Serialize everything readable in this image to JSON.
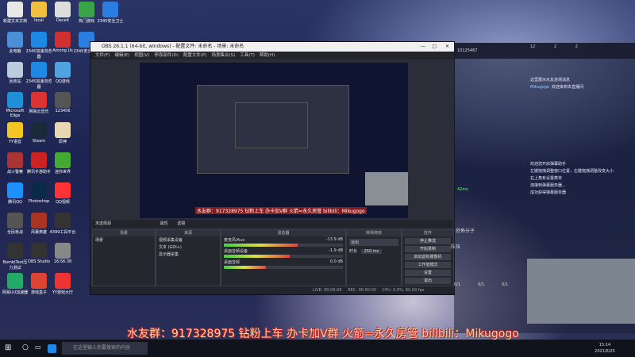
{
  "desktop_icons": [
    {
      "label": "新建文本文档",
      "color": "#e8e8e8"
    },
    {
      "label": "local",
      "color": "#f0c040"
    },
    {
      "label": "Deceit",
      "color": "#ddd"
    },
    {
      "label": "热门游戏",
      "color": "#3aa34a"
    },
    {
      "label": "2345安全卫士",
      "color": "#2a7de1"
    },
    {
      "label": "此电脑",
      "color": "#4a90d9"
    },
    {
      "label": "2345加速浏览器",
      "color": "#1e88e5"
    },
    {
      "label": "Among Us",
      "color": "#d03030"
    },
    {
      "label": "2345安全卫士",
      "color": "#2a7de1"
    },
    {
      "label": "回收站",
      "color": "#bcd"
    },
    {
      "label": "2345加速浏览器",
      "color": "#1e88e5"
    },
    {
      "label": "QQ游戏",
      "color": "#4fa3e0"
    },
    {
      "label": "Microsoft Edge",
      "color": "#1f8fd8"
    },
    {
      "label": "网易云音乐",
      "color": "#d33"
    },
    {
      "label": "123456",
      "color": "#555"
    },
    {
      "label": "YY语音",
      "color": "#f3c623"
    },
    {
      "label": "Steam",
      "color": "#1b2838"
    },
    {
      "label": "原神",
      "color": "#e9d7b0"
    },
    {
      "label": "战斗警察",
      "color": "#a33"
    },
    {
      "label": "腾讯手游助手",
      "color": "#c22"
    },
    {
      "label": "迷你世界",
      "color": "#4a3"
    },
    {
      "label": "腾讯QQ",
      "color": "#1e90ff"
    },
    {
      "label": "Photoshop",
      "color": "#0b2a4a"
    },
    {
      "label": "QQ视频",
      "color": "#f33"
    },
    {
      "label": "全民枪战",
      "color": "#555"
    },
    {
      "label": "风暴英雄",
      "color": "#a32"
    },
    {
      "label": "4399工具平台",
      "color": "#333"
    },
    {
      "label": "BombiTest压力测试",
      "color": "#333"
    },
    {
      "label": "OBS Studio",
      "color": "#333"
    },
    {
      "label": "16:56:38",
      "color": "#888"
    },
    {
      "label": "网易UU加速器",
      "color": "#2a6"
    },
    {
      "label": "游戏盒子",
      "color": "#d43"
    },
    {
      "label": "YY游戏大厅",
      "color": "#e33"
    }
  ],
  "taskbar": {
    "search_placeholder": "在这里输入你要搜索的内容",
    "time": "15:14",
    "date": "2021/6/25"
  },
  "obs": {
    "title": "OBS 26.1.1 (64-bit, windows) - 配置文件: 未命名 - 场景: 未命名",
    "menu": [
      "文件(F)",
      "编辑(E)",
      "视图(V)",
      "停靠部件(D)",
      "配置文件(P)",
      "场景集合(S)",
      "工具(T)",
      "帮助(H)"
    ],
    "source_bar": "未选择源",
    "source_bar_buttons": [
      "属性",
      "滤镜"
    ],
    "docks": {
      "scenes": "场景",
      "sources": "来源",
      "mixer": "混音器",
      "transitions": "转场特效",
      "controls": "控件"
    },
    "scene_items": [
      "场景"
    ],
    "source_items": [
      "视频采集设备",
      "文本 (GDI+)",
      "显示器采集"
    ],
    "mixer": [
      {
        "name": "麦克风/Aux",
        "db": "-13.9 dB",
        "level": 0.62
      },
      {
        "name": "桌面音频设备",
        "db": "-1.9 dB",
        "level": 0.55
      },
      {
        "name": "桌面音频",
        "db": "0.0 dB",
        "level": 0.35
      }
    ],
    "transition": {
      "type": "淡出",
      "duration_label": "时长",
      "duration": "250 ms"
    },
    "controls": [
      "停止推流",
      "开始录制",
      "启动虚拟摄像机",
      "工作室模式",
      "设置",
      "退出"
    ],
    "status": {
      "live": "LIVE: 00:00:00",
      "rec": "REC: 00:00:00",
      "cpu": "CPU: 0.5%, 60.00 fps"
    }
  },
  "chat": {
    "room_id": "10125467",
    "stats": [
      "12",
      "2",
      "2"
    ],
    "messages": [
      {
        "user": "",
        "text": "这里展示水友进场消息"
      },
      {
        "user": "Mikugogo",
        "text": "欢迎来到本直播间"
      },
      {
        "user": "",
        "text": "欢迎您开启弹幕助手"
      },
      {
        "user": "",
        "text": "左键拖拽调整窗口位置，右键拖拽调整改变大小"
      },
      {
        "user": "",
        "text": "右上角有设置菜单"
      },
      {
        "user": "",
        "text": "连接到弹幕服务器..."
      },
      {
        "user": "",
        "text": "成功获得弹幕服务器"
      }
    ],
    "ping": "42ms",
    "viewer_label": "恐怖分子",
    "team_label": "队伍",
    "counts": [
      "0/1",
      "0/1",
      "0/1"
    ]
  },
  "overlay": {
    "main": "水友群：917328975 钻粉上车 办卡加V群 火箭=永久房管 bilibili：Mikugogo",
    "preview": "水友群：917328975 钻粉上车 办卡加V群 火箭=永久房管 bilibili：Mikugogo"
  }
}
